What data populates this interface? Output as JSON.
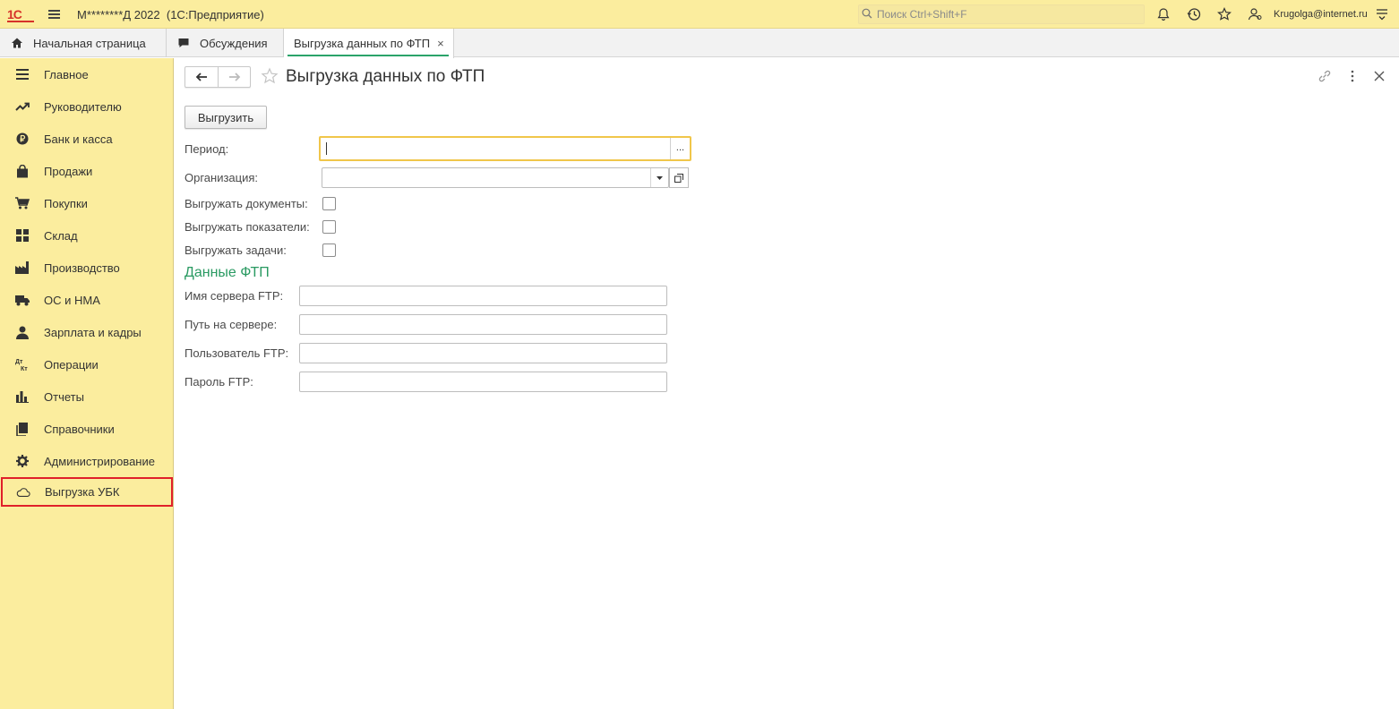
{
  "topbar": {
    "logo_text": "1С",
    "app_title": "М********Д 2022  (1С:Предприятие)",
    "search_placeholder": "Поиск Ctrl+Shift+F",
    "user": "Krugolga@internet.ru",
    "icons": [
      "bell-icon",
      "history-icon",
      "favorites-star-icon",
      "user-icon",
      "settings-menu-icon"
    ]
  },
  "tabs": [
    {
      "label": "Начальная страница",
      "icon": "home-icon"
    },
    {
      "label": "Обсуждения",
      "icon": "chat-icon"
    },
    {
      "label": "Выгрузка данных по ФТП",
      "close": "×",
      "active": true
    }
  ],
  "sidebar": {
    "items": [
      {
        "label": "Главное",
        "icon": "list-icon"
      },
      {
        "label": "Руководителю",
        "icon": "trend-icon"
      },
      {
        "label": "Банк и касса",
        "icon": "ruble-icon"
      },
      {
        "label": "Продажи",
        "icon": "shopping-bag-icon"
      },
      {
        "label": "Покупки",
        "icon": "cart-icon"
      },
      {
        "label": "Склад",
        "icon": "warehouse-icon"
      },
      {
        "label": "Производство",
        "icon": "factory-icon"
      },
      {
        "label": "ОС и НМА",
        "icon": "truck-icon"
      },
      {
        "label": "Зарплата и кадры",
        "icon": "person-icon"
      },
      {
        "label": "Операции",
        "icon": "dt-kt-icon"
      },
      {
        "label": "Отчеты",
        "icon": "bar-chart-icon"
      },
      {
        "label": "Справочники",
        "icon": "books-icon"
      },
      {
        "label": "Администрирование",
        "icon": "gear-icon"
      },
      {
        "label": "Выгрузка УБК",
        "icon": "cloud-icon",
        "highlighted": true
      }
    ]
  },
  "form": {
    "title": "Выгрузка данных по ФТП",
    "export_button": "Выгрузить",
    "period_label": "Период:",
    "period_value": "",
    "period_select": "...",
    "organization_label": "Организация:",
    "organization_value": "",
    "export_documents_label": "Выгружать документы:",
    "export_documents_checked": false,
    "export_indicators_label": "Выгружать показатели:",
    "export_indicators_checked": false,
    "export_tasks_label": "Выгружать задачи:",
    "export_tasks_checked": false,
    "ftp_section_title": "Данные ФТП",
    "ftp_server_label": "Имя сервера FTP:",
    "ftp_server_value": "",
    "ftp_path_label": "Путь на сервере:",
    "ftp_path_value": "",
    "ftp_user_label": "Пользователь FTP:",
    "ftp_user_value": "",
    "ftp_password_label": "Пароль FTP:",
    "ftp_password_value": ""
  },
  "colors": {
    "panel_yellow": "#fbed9e",
    "accent_green": "#2a9a62",
    "highlight_red": "#e0202a",
    "focus_yellow": "#f0c64a"
  }
}
